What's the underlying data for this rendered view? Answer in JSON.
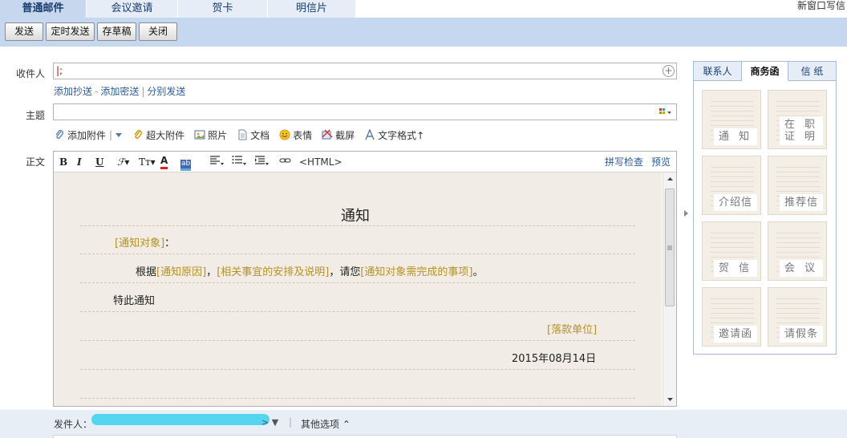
{
  "top_tabs": [
    "普通邮件",
    "会议邀请",
    "贺卡",
    "明信片"
  ],
  "new_window": "新窗口写信",
  "toolbar": {
    "send": "发送",
    "timed_send": "定时发送",
    "save_draft": "存草稿",
    "close": "关闭"
  },
  "form": {
    "to_label": "收件人",
    "to_value": "|;",
    "add_cc": "添加抄送",
    "add_bcc": "添加密送",
    "separate_send": "分别发送",
    "subject_label": "主题",
    "body_label": "正文"
  },
  "attach": {
    "add_attachment": "添加附件",
    "large_attachment": "超大附件",
    "photo": "照片",
    "document": "文档",
    "emoji": "表情",
    "screenshot": "截屏",
    "text_format": "文字格式↑"
  },
  "editor": {
    "html_label": "<HTML>",
    "spell_check": "拼写检查",
    "preview": "预览"
  },
  "notice": {
    "title": "通知",
    "target": "[通知对象]",
    "colon": "：",
    "p_prefix": "根据",
    "p_reason": "[通知原因]",
    "p_comma1": "，",
    "p_arrange": "[相关事宜的安排及说明]",
    "p_mid": "，请您",
    "p_todo": "[通知对象需完成的事项]",
    "p_end": "。",
    "closing": "特此通知",
    "sign_unit": "[落款单位]",
    "date": "2015年08月14日"
  },
  "right_panel": {
    "tabs": [
      "联系人",
      "商务函",
      "信 纸"
    ],
    "templates": [
      "通 知",
      "在 职\n证 明",
      "介绍信",
      "推荐信",
      "贺 信",
      "会 议",
      "邀请函",
      "请假条"
    ]
  },
  "bottom": {
    "sender_label": "发件人：",
    "sender_suffix": "> ▼",
    "other_options": "其他选项 ⌃"
  },
  "colors": {
    "toolbar_bg": "#c5d8ef",
    "tab_active": "#c6d7ee",
    "paper": "#f1ece5",
    "placeholder": "#b59222",
    "link": "#2b5aa0"
  }
}
